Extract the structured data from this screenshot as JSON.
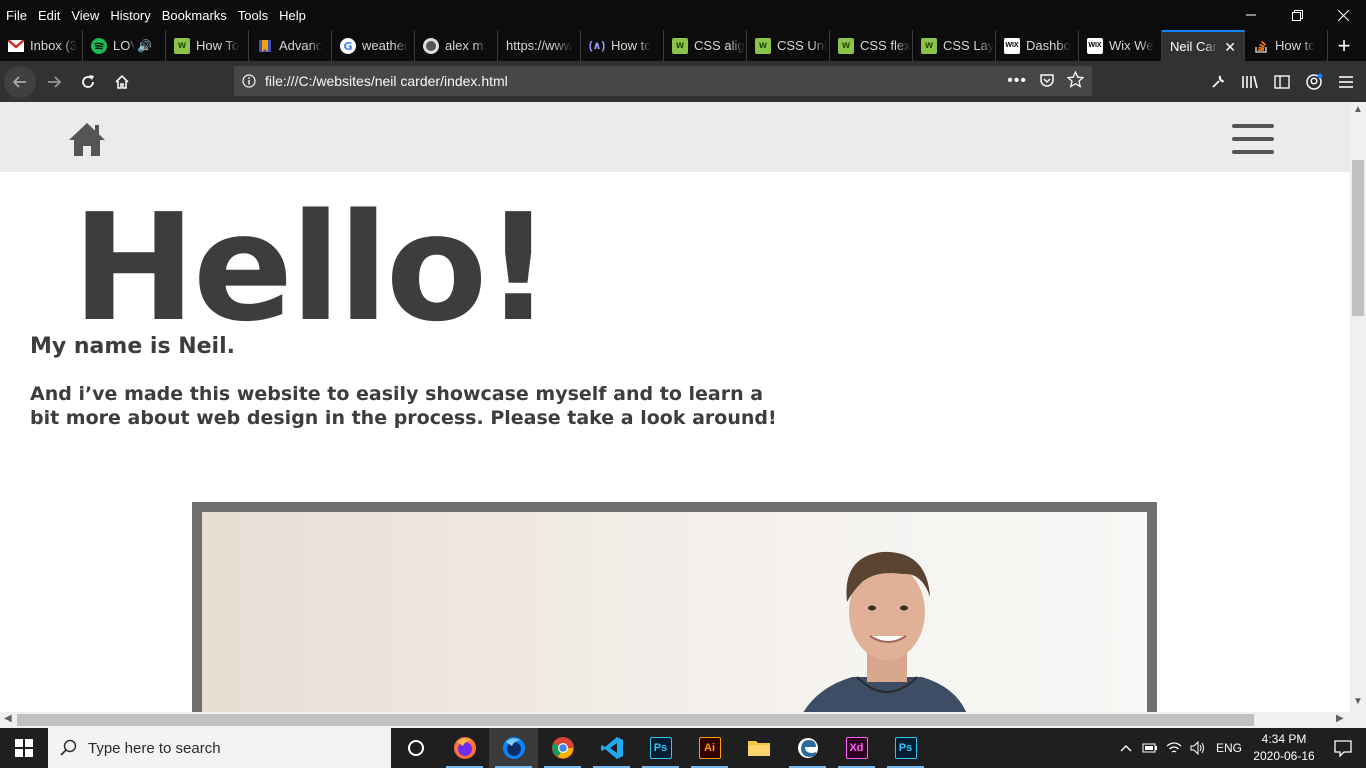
{
  "menubar": {
    "items": [
      "File",
      "Edit",
      "View",
      "History",
      "Bookmarks",
      "Tools",
      "Help"
    ]
  },
  "tabs": [
    {
      "label": "Inbox (3",
      "icon": "gmail-icon",
      "color": "#d93025"
    },
    {
      "label": "LOVE",
      "icon": "spotify-icon",
      "color": "#1db954"
    },
    {
      "label": "How To",
      "icon": "green-grid-icon",
      "color": "#8bc34a"
    },
    {
      "label": "Advanc",
      "icon": "bookmark-icon",
      "color": "#f0a30a"
    },
    {
      "label": "weather",
      "icon": "google-icon",
      "color": "#ffffff"
    },
    {
      "label": "alex m.",
      "icon": "github-icon",
      "color": "#ffffff"
    },
    {
      "label": "https://www",
      "icon": "",
      "color": ""
    },
    {
      "label": "How to",
      "icon": "code-icon",
      "color": "#7f7fff"
    },
    {
      "label": "CSS alig",
      "icon": "green-grid-icon",
      "color": "#8bc34a"
    },
    {
      "label": "CSS Uni",
      "icon": "green-grid-icon",
      "color": "#8bc34a"
    },
    {
      "label": "CSS flex",
      "icon": "green-grid-icon",
      "color": "#8bc34a"
    },
    {
      "label": "CSS Lay",
      "icon": "green-grid-icon",
      "color": "#8bc34a"
    },
    {
      "label": "Dashbo",
      "icon": "wix-icon",
      "color": "#ffffff"
    },
    {
      "label": "Wix We",
      "icon": "wix-icon",
      "color": "#ffffff"
    },
    {
      "label": "Neil Carc",
      "icon": "",
      "color": "",
      "active": true
    },
    {
      "label": "How to",
      "icon": "stackoverflow-icon",
      "color": "#f48024"
    }
  ],
  "urlbar": {
    "url": "file:///C:/websites/neil carder/index.html"
  },
  "page": {
    "hello": "Hello!",
    "name": "My name is Neil.",
    "intro": "And i’ve made this website to easily showcase myself and to learn a bit more about web design in the process. Please take a look around!"
  },
  "taskbar": {
    "search_placeholder": "Type here to search",
    "language": "ENG",
    "time": "4:34 PM",
    "date": "2020-06-16"
  },
  "colors": {
    "heading": "#3d3d3d",
    "header_bg": "#ebebeb",
    "frame": "#6f6f6f",
    "accent": "#0a84ff"
  }
}
